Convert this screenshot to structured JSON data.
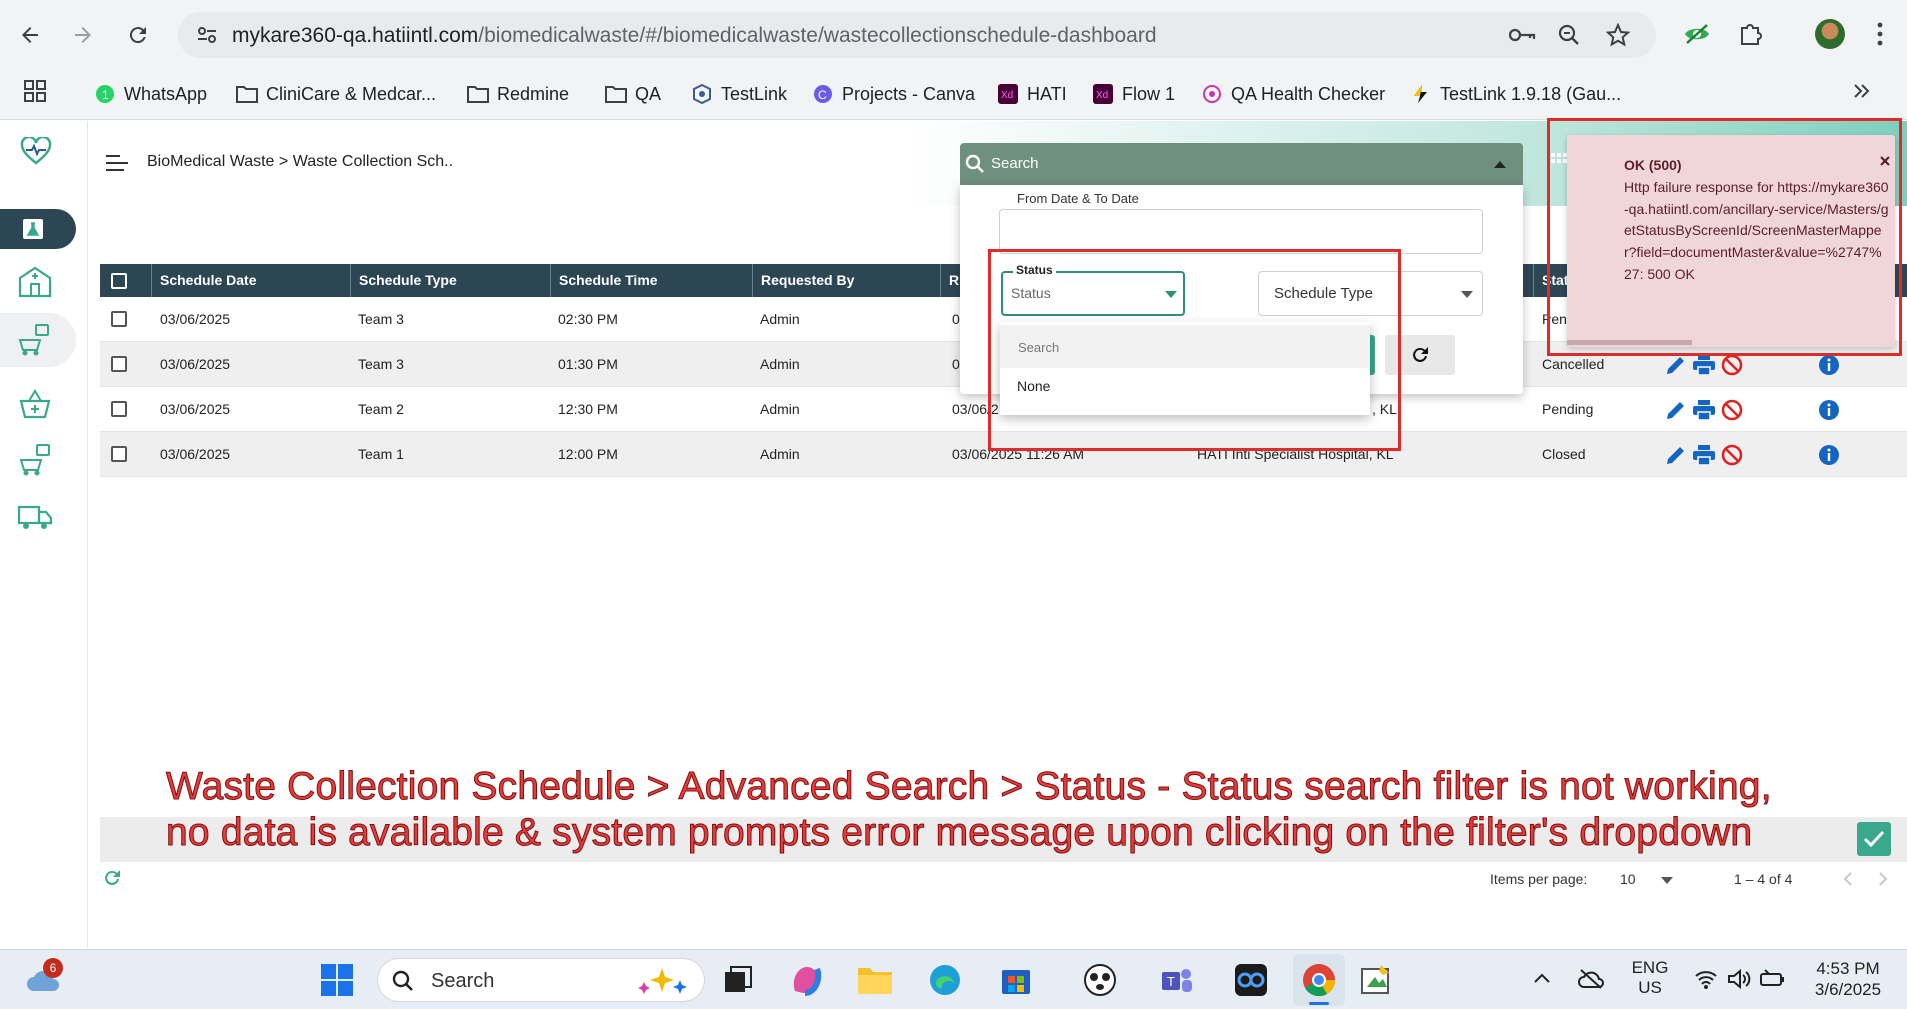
{
  "browser": {
    "url_domain": "mykare360-qa.hatiintl.com",
    "url_path": "/biomedicalwaste/#/biomedicalwaste/wastecollectionschedule-dashboard",
    "bookmarks": [
      "WhatsApp",
      "CliniCare & Medcar...",
      "Redmine",
      "QA",
      "TestLink",
      "Projects - Canva",
      "HATI",
      "Flow 1",
      "QA Health Checker",
      "TestLink 1.9.18 (Gau..."
    ]
  },
  "header": {
    "breadcrumb": "BioMedical Waste > Waste Collection Sch.."
  },
  "table": {
    "columns": [
      "Schedule Date",
      "Schedule Type",
      "Schedule Time",
      "Requested By",
      "R",
      "Stat"
    ],
    "rows": [
      {
        "date": "03/06/2025",
        "type": "Team 3",
        "time": "02:30 PM",
        "by": "Admin",
        "requested_on": "0",
        "location": "",
        "status": "Pen"
      },
      {
        "date": "03/06/2025",
        "type": "Team 3",
        "time": "01:30 PM",
        "by": "Admin",
        "requested_on": "0",
        "location": "",
        "status": "Cancelled"
      },
      {
        "date": "03/06/2025",
        "type": "Team 2",
        "time": "12:30 PM",
        "by": "Admin",
        "requested_on": "03/06/2",
        "location": ", KL",
        "status": "Pending"
      },
      {
        "date": "03/06/2025",
        "type": "Team 1",
        "time": "12:00 PM",
        "by": "Admin",
        "requested_on": "03/06/2025 11:26 AM",
        "location": "HATI Inti Specialist Hospital, KL",
        "status": "Closed"
      }
    ]
  },
  "paginator": {
    "items_per_page_label": "Items per page:",
    "page_size": "10",
    "range": "1 – 4 of 4"
  },
  "search": {
    "title": "Search",
    "date_label": "From Date & To Date",
    "status_label": "Status",
    "status_placeholder": "Status",
    "schedule_type_placeholder": "Schedule Type",
    "dropdown_search_placeholder": "Search",
    "dropdown_option": "None"
  },
  "toast": {
    "title": "OK (500)",
    "message": "Http failure response for https://mykare360-qa.hatiintl.com/ancillary-service/Masters/getStatusByScreenId/ScreenMasterMapper?field=documentMaster&value=%2747%27: 500 OK"
  },
  "annotation": {
    "line1": "Waste Collection Schedule > Advanced Search > Status - Status search filter is not working,",
    "line2": "no data is available & system prompts error message upon clicking on the filter's dropdown"
  },
  "taskbar": {
    "weather_badge": "6",
    "search_label": "Search",
    "lang_line1": "ENG",
    "lang_line2": "US",
    "time": "4:53 PM",
    "date": "3/6/2025"
  },
  "colors": {
    "table_header": "#2d4654",
    "accent": "#3aa88c",
    "error_bg": "#f1d6d9",
    "annotation": "#ea3b3b"
  }
}
